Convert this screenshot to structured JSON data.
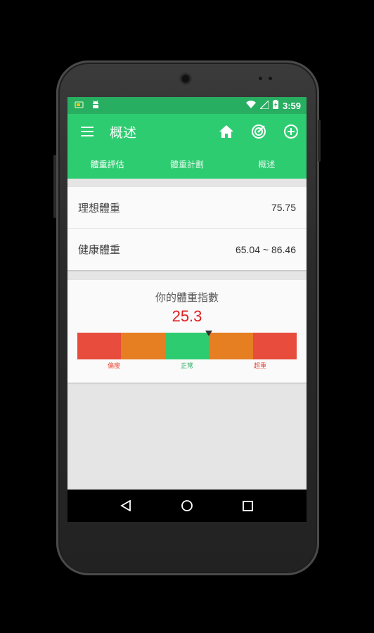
{
  "statusbar": {
    "time": "3:59"
  },
  "appbar": {
    "title": "概述"
  },
  "tabs": [
    {
      "label": "體重評估"
    },
    {
      "label": "體重計劃"
    },
    {
      "label": "概述"
    }
  ],
  "weights": [
    {
      "label": "理想體重",
      "value": "75.75"
    },
    {
      "label": "健康體重",
      "value": "65.04 ~ 86.46"
    }
  ],
  "bmi": {
    "title": "你的體重指數",
    "value": "25.3",
    "marker_fraction": 0.6,
    "segments": [
      {
        "color": "#e74c3c"
      },
      {
        "color": "#e67e22"
      },
      {
        "color": "#2ecc71"
      },
      {
        "color": "#e67e22"
      },
      {
        "color": "#e74c3c"
      }
    ],
    "labels": [
      {
        "text": "偏瘦",
        "color": "#e74c3c"
      },
      {
        "text": "正常",
        "color": "#27ae60"
      },
      {
        "text": "超重",
        "color": "#e74c3c"
      }
    ]
  },
  "colors": {
    "primary": "#2ecc71",
    "status": "#27ae60",
    "accent_red": "#e02020"
  }
}
